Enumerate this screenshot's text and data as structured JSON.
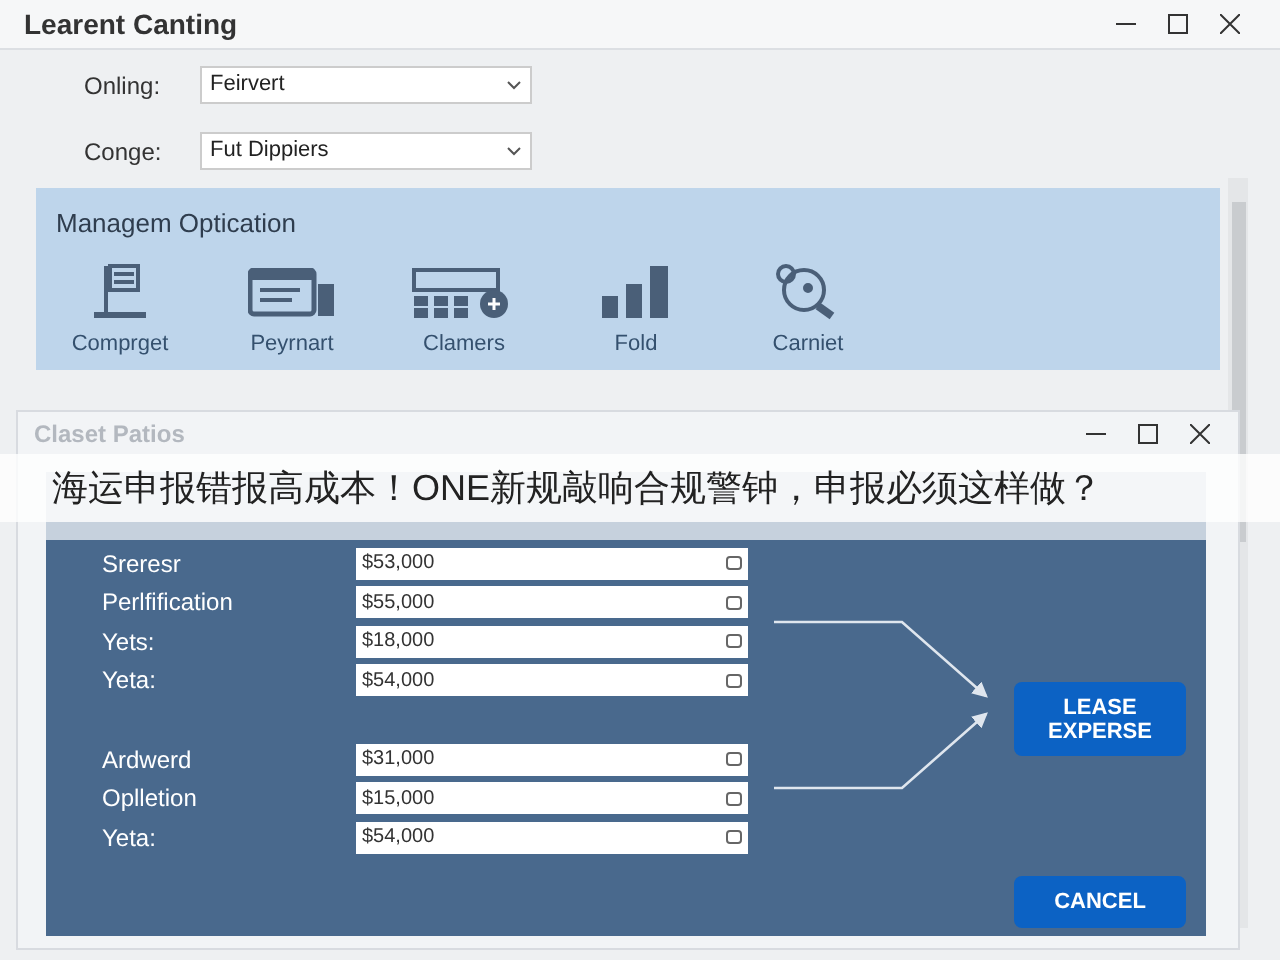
{
  "window": {
    "title": "Learent Canting"
  },
  "fields": [
    {
      "label": "Onling:",
      "value": "Feirvert"
    },
    {
      "label": "Conge:",
      "value": "Fut Dippiers"
    }
  ],
  "panel": {
    "title": "Managem Optication",
    "items": [
      {
        "kind": "ledger",
        "label": "Comprget"
      },
      {
        "kind": "payment",
        "label": "Peyrnart"
      },
      {
        "kind": "calculator",
        "label": "Clamers"
      },
      {
        "kind": "bars",
        "label": "Fold"
      },
      {
        "kind": "magnifier",
        "label": "Carniet"
      }
    ]
  },
  "dialog": {
    "title": "Claset Patios",
    "groups": [
      [
        {
          "label": "Sreresr",
          "value": "$53,000"
        },
        {
          "label": "Perlfification",
          "value": "$55,000"
        },
        {
          "label": "Yets:",
          "value": "$18,000"
        },
        {
          "label": "Yeta:",
          "value": "$54,000"
        }
      ],
      [
        {
          "label": "Ardwerd",
          "value": "$31,000"
        },
        {
          "label": "Oplletion",
          "value": "$15,000"
        },
        {
          "label": "Yeta:",
          "value": "$54,000"
        }
      ]
    ],
    "buttons": [
      "LEASE EXPERSE",
      "CANCEL"
    ]
  },
  "banner": {
    "text": "海运申报错报高成本！ONE新规敲响合规警钟，申报必须这样做？"
  }
}
